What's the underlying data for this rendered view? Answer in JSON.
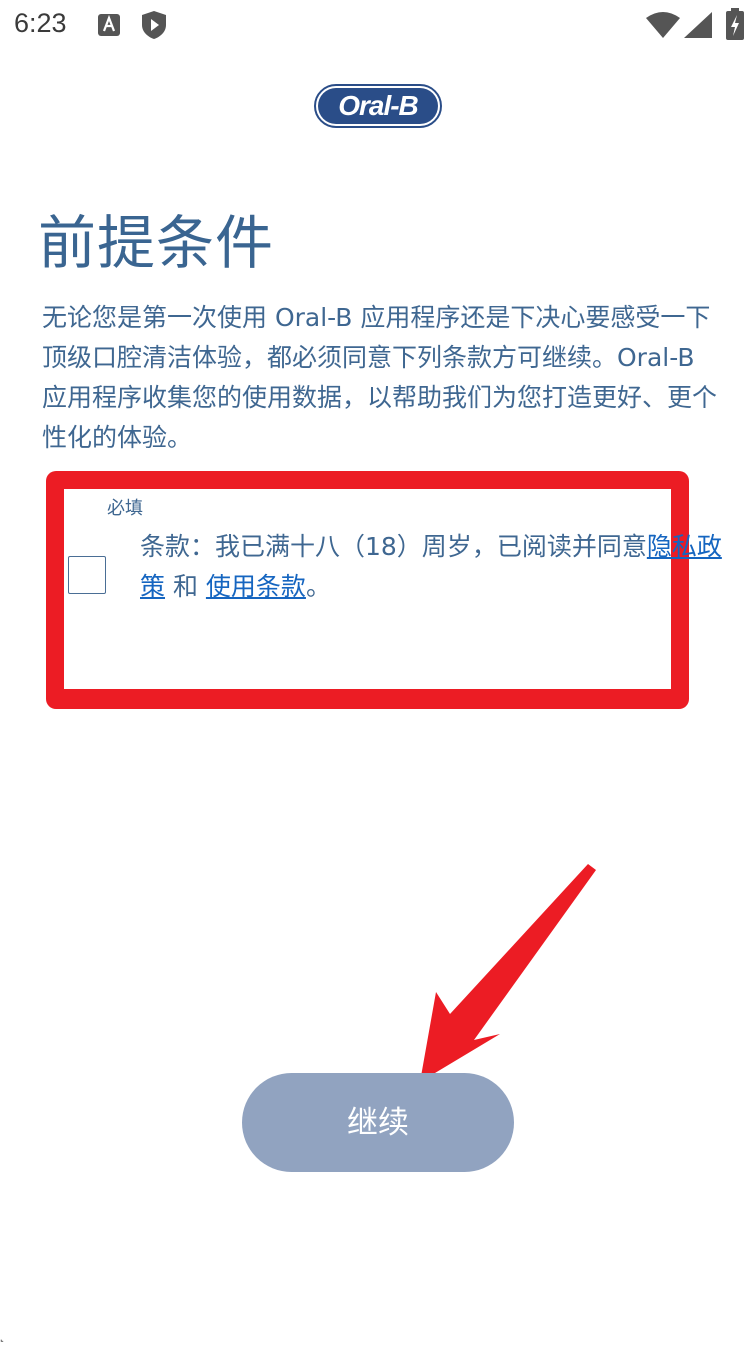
{
  "status_bar": {
    "time": "6:23",
    "icons": [
      "font-icon",
      "shield-play-icon",
      "wifi-icon",
      "signal-icon",
      "battery-charging-icon"
    ]
  },
  "logo": {
    "text": "Oral-B",
    "color": "#2a4d88"
  },
  "page": {
    "title": "前提条件",
    "intro": "无论您是第一次使用 Oral-B 应用程序还是下决心要感受一下顶级口腔清洁体验，都必须同意下列条款方可继续。Oral-B 应用程序收集您的使用数据，以帮助我们为您打造更好、更个性化的体验。"
  },
  "consent": {
    "required_label": "必填",
    "checked": false,
    "text_prefix": "条款：我已满十八（18）周岁，已阅读并同意",
    "privacy_link": "隐私政策",
    "connector": " 和 ",
    "terms_link": "使用条款",
    "text_suffix": "。"
  },
  "continue_button": {
    "label": "继续"
  },
  "colors": {
    "heading": "#3a6591",
    "body_text": "#3f6791",
    "link": "#1565c0",
    "annotation_red": "#ec1c24",
    "button_bg": "#91a3c0"
  }
}
